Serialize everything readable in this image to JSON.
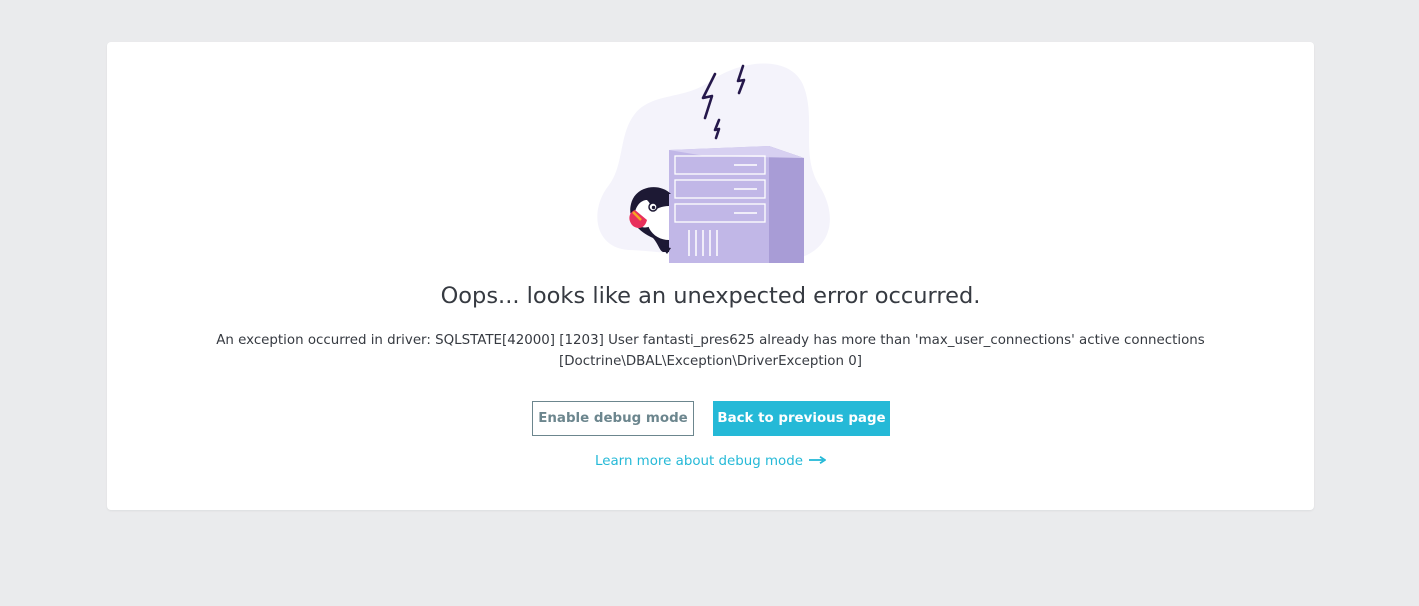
{
  "error": {
    "title": "Oops... looks like an unexpected error occurred.",
    "message_line1": "An exception occurred in driver: SQLSTATE[42000] [1203] User fantasti_pres625 already has more than 'max_user_connections' active connections",
    "message_line2": "[Doctrine\\DBAL\\Exception\\DriverException 0]"
  },
  "actions": {
    "debug_button_label": "Enable debug mode",
    "back_button_label": "Back to previous page",
    "learn_more_label": "Learn more about debug mode"
  },
  "illustration": {
    "subject": "puffin-peeking-behind-server-with-lightning-icon"
  },
  "colors": {
    "accent": "#25b9d7",
    "secondary": "#6c868e",
    "text": "#363a41",
    "background": "#eaebed",
    "server": "#bdb3e3",
    "blob": "#f4f3fb",
    "lightning": "#25184b"
  }
}
